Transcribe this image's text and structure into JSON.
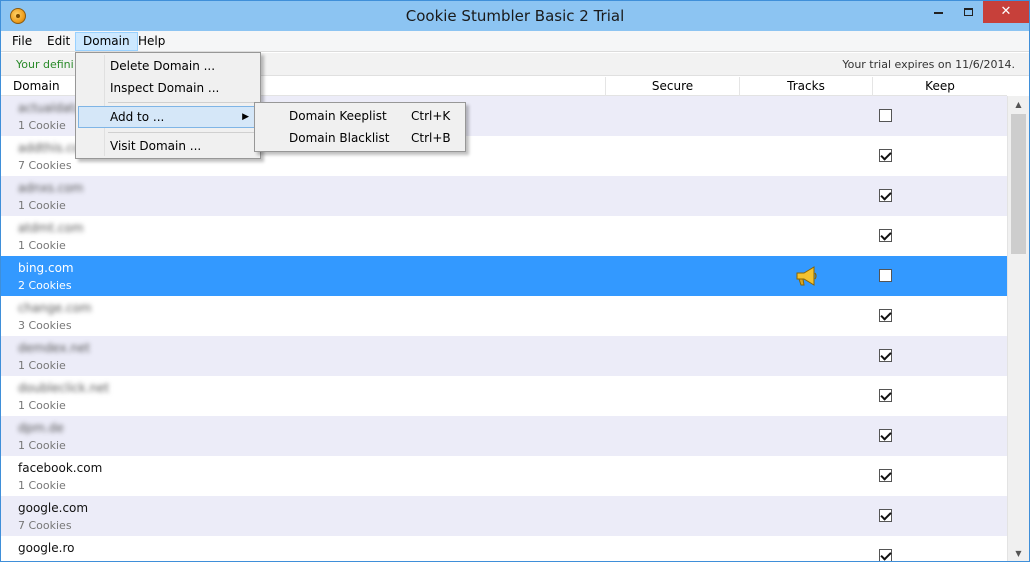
{
  "window": {
    "title": "Cookie Stumbler Basic 2 Trial",
    "close_glyph": "✕",
    "accent": "#3399ff"
  },
  "menubar": {
    "items": [
      "File",
      "Edit",
      "Domain",
      "Help"
    ]
  },
  "infobar": {
    "left_text": "Your defini",
    "right_text": "Your trial expires on 11/6/2014."
  },
  "columns": {
    "domain": "Domain",
    "secure": "Secure",
    "tracks": "Tracks",
    "keep": "Keep"
  },
  "domain_menu": {
    "items": [
      "Delete Domain ...",
      "Inspect Domain ...",
      "Add to ...",
      "Visit Domain ..."
    ]
  },
  "add_to_submenu": {
    "items": [
      {
        "label": "Domain Keeplist",
        "shortcut": "Ctrl+K"
      },
      {
        "label": "Domain Blacklist",
        "shortcut": "Ctrl+B"
      }
    ]
  },
  "rows": [
    {
      "name": "actualdata.com",
      "count": "1 Cookie",
      "keep": false
    },
    {
      "name": "addthis.com",
      "count": "7 Cookies",
      "keep": true
    },
    {
      "name": "adnxs.com",
      "count": "1 Cookie",
      "keep": true
    },
    {
      "name": "atdmt.com",
      "count": "1 Cookie",
      "keep": true
    },
    {
      "name": "bing.com",
      "count": "2 Cookies",
      "keep": false,
      "selected": true,
      "tracks_icon": "megaphone-icon"
    },
    {
      "name": "change.com",
      "count": "3 Cookies",
      "keep": true
    },
    {
      "name": "demdex.net",
      "count": "1 Cookie",
      "keep": true
    },
    {
      "name": "doubleclick.net",
      "count": "1 Cookie",
      "keep": true
    },
    {
      "name": "dpm.de",
      "count": "1 Cookie",
      "keep": true
    },
    {
      "name": "facebook.com",
      "count": "1 Cookie",
      "keep": true
    },
    {
      "name": "google.com",
      "count": "7 Cookies",
      "keep": true
    },
    {
      "name": "google.ro",
      "count": "",
      "keep": true
    }
  ]
}
